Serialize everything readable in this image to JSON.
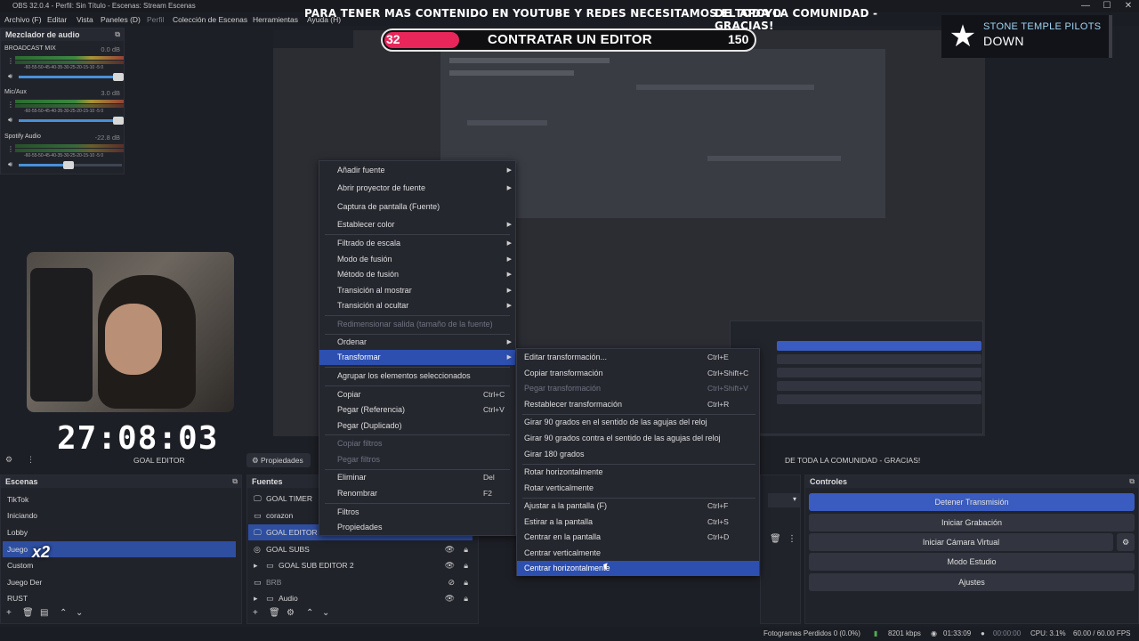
{
  "window": {
    "title": "OBS 32.0.4 - Perfil: Sin Título - Escenas: Stream Escenas",
    "min": "—",
    "max": "☐",
    "close": "✕"
  },
  "menubar": [
    "Archivo (F)",
    "Editar",
    "Vista",
    "Paneles (D)",
    "Perfil",
    "Colección de Escenas",
    "Herramientas",
    "Ayuda (H)"
  ],
  "overlay": {
    "banner_left": "PARA TENER MAS CONTENIDO EN YOUTUBE Y REDES NECESITAMOS EL APOYO",
    "banner_right": "DE TODA LA COMUNIDAD - GRACIAS!",
    "goal_current": "32",
    "goal_title": "CONTRATAR UN EDITOR",
    "goal_target": "150",
    "now_playing_artist": "STONE TEMPLE PILOTS",
    "now_playing_song": "DOWN",
    "timer": "27:08:03",
    "badge": "x2"
  },
  "mixer": {
    "title": "Mezclador de audio",
    "channels": [
      {
        "name": "BROADCAST MIX",
        "db": "0.0 dB",
        "volume": 1.0
      },
      {
        "name": "Mic/Aux",
        "db": "3.0 dB",
        "volume": 1.0
      },
      {
        "name": "Spotify Audio",
        "db": "-22.8 dB",
        "volume": 0.5
      }
    ],
    "ticks": "-60-55-50-45-40-35-30-25-20-15-10 -5  0"
  },
  "dock": {
    "goal_editor": "GOAL EDITOR",
    "properties": "Propiedades",
    "ticker": "DE TODA LA COMUNIDAD - GRACIAS!"
  },
  "scenes": {
    "title": "Escenas",
    "items": [
      "TikTok",
      "Iniciando",
      "Lobby",
      "Juego",
      "Custom",
      "Juego Der",
      "RUST"
    ],
    "selected_index": 3
  },
  "sources": {
    "title": "Fuentes",
    "items": [
      {
        "name": "GOAL TIMER",
        "icon": "🖵"
      },
      {
        "name": "corazon",
        "icon": "▭"
      },
      {
        "name": "GOAL EDITOR",
        "icon": "🖵"
      },
      {
        "name": "GOAL SUBS",
        "icon": "◎"
      },
      {
        "name": "GOAL SUB EDITOR 2",
        "icon": "▸"
      },
      {
        "name": "BRB",
        "icon": "▭"
      },
      {
        "name": "Audio",
        "icon": "▸"
      }
    ],
    "selected_index": 2
  },
  "controls": {
    "title": "Controles",
    "buttons": [
      "Detener Transmisión",
      "Iniciar Grabación",
      "Iniciar Cámara Virtual",
      "Modo Estudio",
      "Ajustes"
    ]
  },
  "context_menu": {
    "items": [
      {
        "label": "Añadir fuente",
        "sub": true
      },
      {
        "label": "Abrir proyector de fuente",
        "sub": true
      },
      {
        "label": "Captura de pantalla (Fuente)"
      },
      {
        "label": "Establecer color",
        "sub": true
      },
      {
        "label": "Filtrado de escala",
        "sub": true
      },
      {
        "label": "Modo de fusión",
        "sub": true
      },
      {
        "label": "Método de fusión",
        "sub": true
      },
      {
        "label": "Transición al mostrar",
        "sub": true
      },
      {
        "label": "Transición al ocultar",
        "sub": true
      },
      {
        "label": "Redimensionar salida (tamaño de la fuente)",
        "disabled": true
      },
      {
        "label": "Ordenar",
        "sub": true
      },
      {
        "label": "Transformar",
        "sub": true,
        "highlight": true
      },
      {
        "label": "Agrupar los elementos seleccionados"
      },
      {
        "label": "Copiar",
        "shortcut": "Ctrl+C"
      },
      {
        "label": "Pegar (Referencia)",
        "shortcut": "Ctrl+V"
      },
      {
        "label": "Pegar (Duplicado)"
      },
      {
        "label": "Copiar filtros",
        "disabled": true
      },
      {
        "label": "Pegar filtros",
        "disabled": true
      },
      {
        "label": "Eliminar",
        "shortcut": "Del"
      },
      {
        "label": "Renombrar",
        "shortcut": "F2"
      },
      {
        "label": "Filtros"
      },
      {
        "label": "Propiedades"
      }
    ]
  },
  "transform_menu": {
    "items": [
      {
        "label": "Editar transformación...",
        "shortcut": "Ctrl+E"
      },
      {
        "label": "Copiar transformación",
        "shortcut": "Ctrl+Shift+C"
      },
      {
        "label": "Pegar transformación",
        "shortcut": "Ctrl+Shift+V",
        "disabled": true
      },
      {
        "label": "Restablecer transformación",
        "shortcut": "Ctrl+R"
      },
      {
        "label": "Girar 90 grados en el sentido de las agujas del reloj"
      },
      {
        "label": "Girar 90 grados contra el sentido de las agujas del reloj"
      },
      {
        "label": "Girar 180 grados"
      },
      {
        "label": "Rotar horizontalmente"
      },
      {
        "label": "Rotar verticalmente"
      },
      {
        "label": "Ajustar a la pantalla (F)",
        "shortcut": "Ctrl+F"
      },
      {
        "label": "Estirar a la pantalla",
        "shortcut": "Ctrl+S"
      },
      {
        "label": "Centrar en la pantalla",
        "shortcut": "Ctrl+D"
      },
      {
        "label": "Centrar verticalmente"
      },
      {
        "label": "Centrar horizontalmente",
        "highlight": true
      }
    ]
  },
  "status": {
    "dropped": "Fotogramas Perdidos 0 (0.0%)",
    "bitrate": "8201 kbps",
    "stream_time": "01:33:09",
    "rec_time": "00:00:00",
    "cpu": "CPU: 3.1%",
    "fps": "60.00 / 60.00 FPS"
  },
  "colors": {
    "accent": "#2d4fb0",
    "goal_fill": "#e8265a"
  }
}
